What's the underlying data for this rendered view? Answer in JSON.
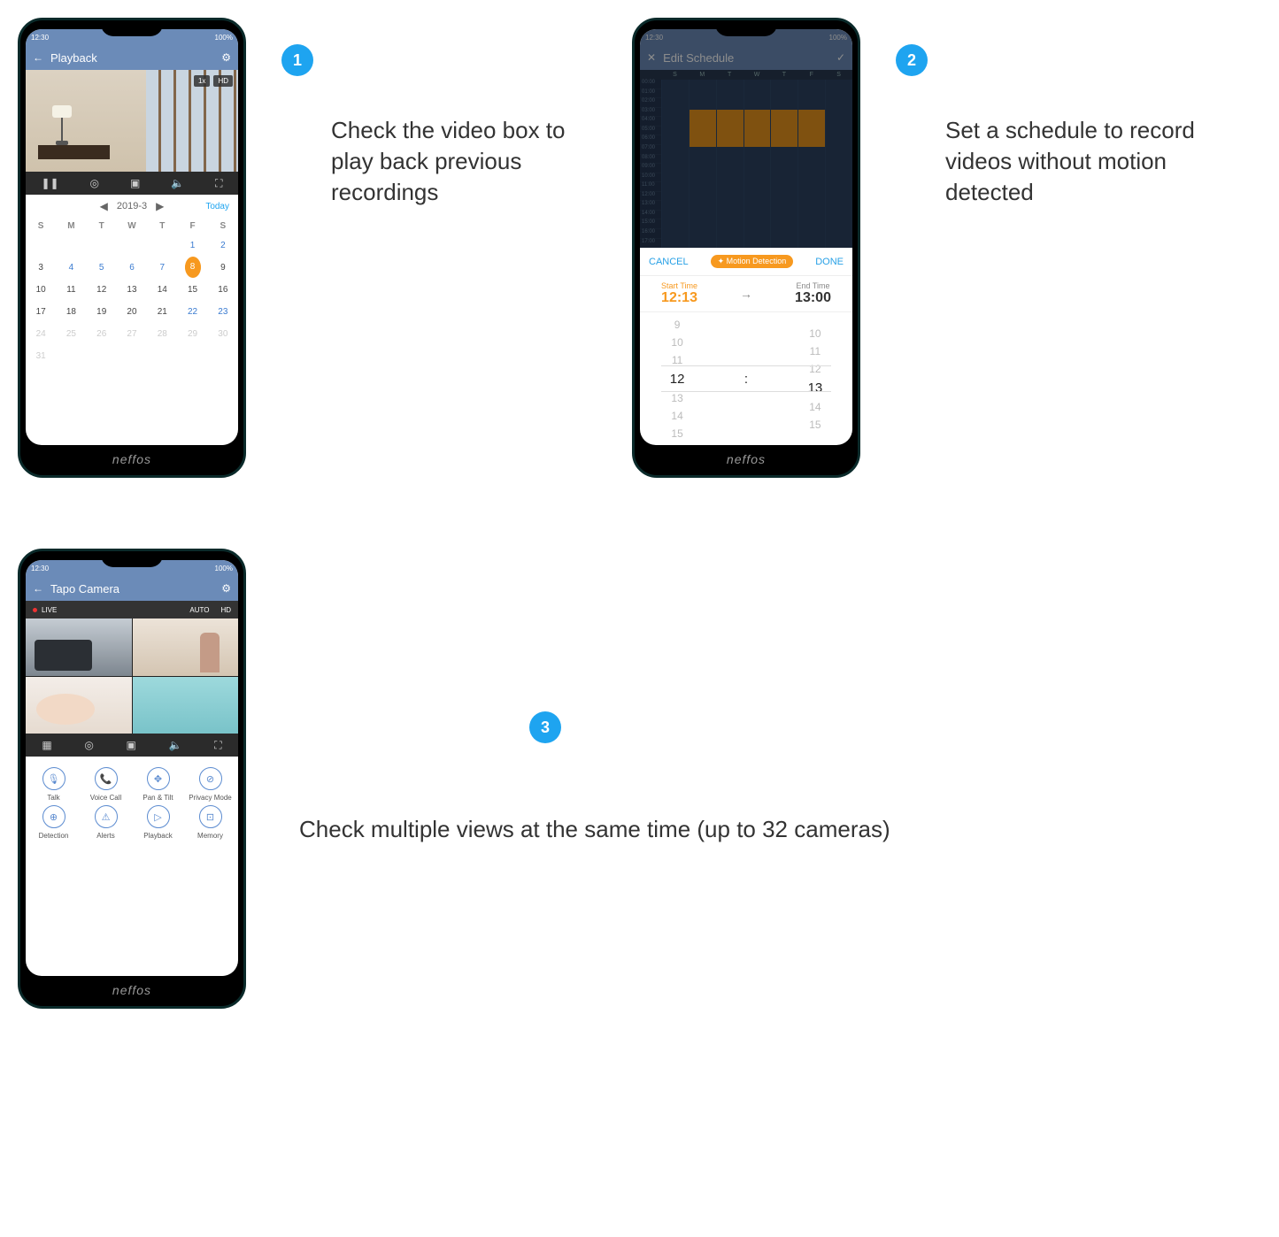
{
  "badges": {
    "b1": "1",
    "b2": "2",
    "b3": "3"
  },
  "captions": {
    "c1": "Check the video box to play back previous recordings",
    "c2": "Set a schedule to record videos without motion detected",
    "c3": "Check multiple views at the same time (up to 32 cameras)"
  },
  "brand": "neffos",
  "status": {
    "time": "12:30",
    "batt": "100%"
  },
  "phone1": {
    "title": "Playback",
    "speed": "1x",
    "hd": "HD",
    "month": "2019-3",
    "today": "Today",
    "dows": [
      "S",
      "M",
      "T",
      "W",
      "T",
      "F",
      "S"
    ],
    "weeks": [
      [
        {
          "t": "",
          "c": ""
        },
        {
          "t": "",
          "c": ""
        },
        {
          "t": "",
          "c": ""
        },
        {
          "t": "",
          "c": ""
        },
        {
          "t": "",
          "c": ""
        },
        {
          "t": "1",
          "c": "blue"
        },
        {
          "t": "2",
          "c": "blue"
        }
      ],
      [
        {
          "t": "3",
          "c": ""
        },
        {
          "t": "4",
          "c": "blue"
        },
        {
          "t": "5",
          "c": "blue"
        },
        {
          "t": "6",
          "c": "blue"
        },
        {
          "t": "7",
          "c": "blue"
        },
        {
          "t": "8",
          "c": "sel"
        },
        {
          "t": "9",
          "c": ""
        }
      ],
      [
        {
          "t": "10",
          "c": ""
        },
        {
          "t": "11",
          "c": ""
        },
        {
          "t": "12",
          "c": ""
        },
        {
          "t": "13",
          "c": ""
        },
        {
          "t": "14",
          "c": ""
        },
        {
          "t": "15",
          "c": ""
        },
        {
          "t": "16",
          "c": ""
        }
      ],
      [
        {
          "t": "17",
          "c": ""
        },
        {
          "t": "18",
          "c": ""
        },
        {
          "t": "19",
          "c": ""
        },
        {
          "t": "20",
          "c": ""
        },
        {
          "t": "21",
          "c": ""
        },
        {
          "t": "22",
          "c": "blue"
        },
        {
          "t": "23",
          "c": "blue"
        }
      ],
      [
        {
          "t": "24",
          "c": "mute"
        },
        {
          "t": "25",
          "c": "mute"
        },
        {
          "t": "26",
          "c": "mute"
        },
        {
          "t": "27",
          "c": "mute"
        },
        {
          "t": "28",
          "c": "mute"
        },
        {
          "t": "29",
          "c": "mute"
        },
        {
          "t": "30",
          "c": "mute"
        }
      ],
      [
        {
          "t": "31",
          "c": "mute"
        },
        {
          "t": "",
          "c": ""
        },
        {
          "t": "",
          "c": ""
        },
        {
          "t": "",
          "c": ""
        },
        {
          "t": "",
          "c": ""
        },
        {
          "t": "",
          "c": ""
        },
        {
          "t": "",
          "c": ""
        }
      ]
    ]
  },
  "phone2": {
    "title": "Edit Schedule",
    "dows": [
      "S",
      "M",
      "T",
      "W",
      "T",
      "F",
      "S"
    ],
    "hours": [
      "00:00",
      "01:00",
      "02:00",
      "03:00",
      "04:00",
      "05:00",
      "06:00",
      "07:00",
      "08:00",
      "09:00",
      "10:00",
      "11:00",
      "12:00",
      "13:00",
      "14:00",
      "15:00",
      "16:00",
      "17:00"
    ],
    "cancel": "CANCEL",
    "done": "DONE",
    "chip": "✦ Motion Detection",
    "startLabel": "Start Time",
    "startVal": "12:13",
    "endLabel": "End Time",
    "endVal": "13:00",
    "wheelL": [
      "9",
      "10",
      "11",
      "12",
      "13",
      "14",
      "15"
    ],
    "wheelR": [
      "10",
      "11",
      "12",
      "13",
      "14",
      "15"
    ]
  },
  "phone3": {
    "title": "Tapo Camera",
    "live": "LIVE",
    "auto": "AUTO",
    "hd": "HD",
    "features": [
      {
        "ic": "🎙",
        "label": "Talk"
      },
      {
        "ic": "📞",
        "label": "Voice Call"
      },
      {
        "ic": "✥",
        "label": "Pan & Tilt"
      },
      {
        "ic": "⊘",
        "label": "Privacy Mode"
      },
      {
        "ic": "⊕",
        "label": "Detection"
      },
      {
        "ic": "⚠",
        "label": "Alerts"
      },
      {
        "ic": "▷",
        "label": "Playback"
      },
      {
        "ic": "⊡",
        "label": "Memory"
      }
    ]
  }
}
